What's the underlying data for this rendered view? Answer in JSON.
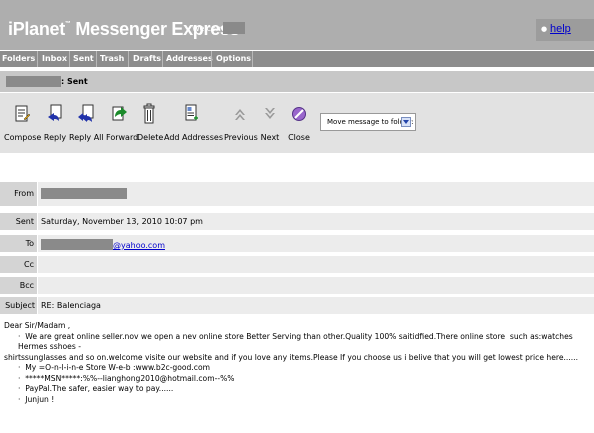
{
  "header": {
    "app_title": "iPlanet",
    "app_title_tm": "™",
    "app_subtitle": "Messenger Express",
    "welcome_label": "Welcome",
    "help_label": "help"
  },
  "nav": {
    "items": [
      "Folders",
      "Inbox",
      "Sent",
      "Trash",
      "Drafts",
      "Addresses",
      "Options"
    ]
  },
  "folder": {
    "title": ": Sent"
  },
  "toolbar": {
    "buttons": [
      {
        "label": "Compose",
        "icon": "compose-icon"
      },
      {
        "label": "Reply",
        "icon": "reply-icon"
      },
      {
        "label": "Reply All",
        "icon": "reply-all-icon"
      },
      {
        "label": "Forward",
        "icon": "forward-icon"
      },
      {
        "label": "Delete",
        "icon": "trash-icon"
      },
      {
        "label": "Add Addresses",
        "icon": "address-book-icon"
      },
      {
        "label": "Previous",
        "icon": "chevron-up-icon"
      },
      {
        "label": "Next",
        "icon": "chevron-down-icon"
      },
      {
        "label": "Close",
        "icon": "close-icon"
      }
    ],
    "move_to_folder": "Move message to folder:"
  },
  "message": {
    "fields": {
      "from_label": "From",
      "sent_label": "Sent",
      "sent_value": "Saturday, November 13, 2010 10:07 pm",
      "to_label": "To",
      "to_value": "@yahoo.com",
      "cc_label": "Cc",
      "cc_value": "",
      "bcc_label": "Bcc",
      "bcc_value": "",
      "subject_label": "Subject",
      "subject_value": "RE: Balenciaga"
    },
    "body": {
      "greeting": "Dear Sir/Madam ,",
      "para1_line1": "We are great online seller.nov we open a nev online store Better Serving than other.Quality 100% saitidfied.There online store  such as:watches Hermes sshoes -",
      "para1_line2": "shirtssunglasses and so on.welcome visite our website and if you love any items.Please If you choose us i belive that you will get lowest price here......",
      "line_store": "My =O-n-l-i-n-e Store W-e-b :www.b2c-good.com",
      "line_msn": "*****MSN*****:%%--lianghong2010@hotmail.com--%%",
      "line_paypal": "PayPal.The safer, easier way to pay......",
      "line_sign": "Junjun !"
    },
    "colors": {
      "header_bg": "#aeaeae",
      "nav_bg": "#8d8d8d",
      "link": "#0000cc"
    }
  }
}
